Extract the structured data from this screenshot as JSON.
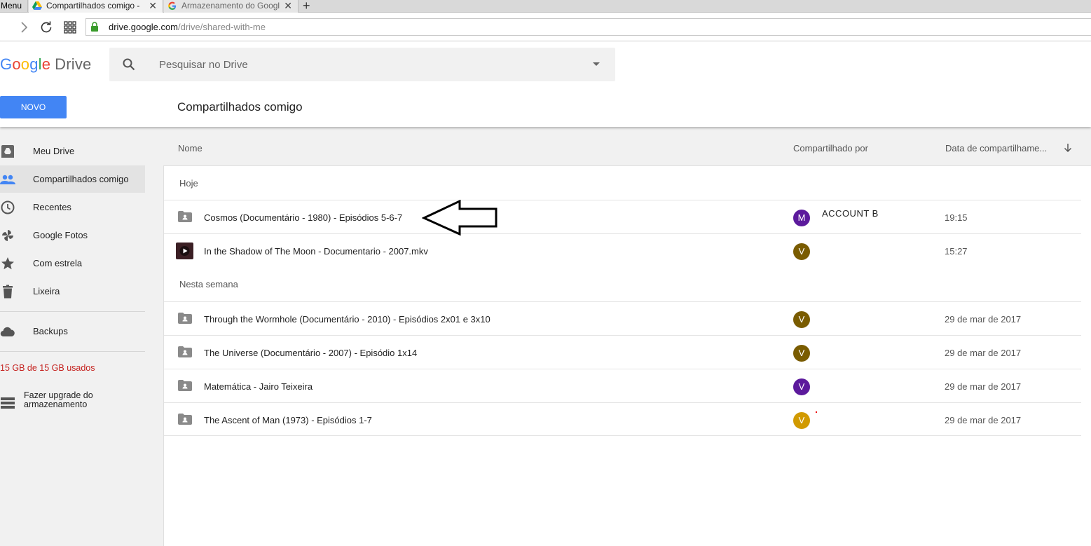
{
  "browser": {
    "menu_label": "Menu",
    "tabs": [
      {
        "title": "Compartilhados comigo -",
        "close": "✕"
      },
      {
        "title": "Armazenamento do Googl",
        "close": "✕"
      }
    ],
    "new_tab": "+",
    "url_domain": "drive.google.com",
    "url_path": "/drive/shared-with-me"
  },
  "header": {
    "logo_google": [
      "G",
      "o",
      "o",
      "g",
      "l",
      "e"
    ],
    "logo_drive": "Drive",
    "search_placeholder": "Pesquisar no Drive",
    "new_button": "NOVO",
    "page_title": "Compartilhados comigo"
  },
  "sidebar": {
    "items": [
      {
        "label": "Meu Drive",
        "icon": "drive-icon"
      },
      {
        "label": "Compartilhados comigo",
        "icon": "people-icon",
        "active": true
      },
      {
        "label": "Recentes",
        "icon": "clock-icon"
      },
      {
        "label": "Google Fotos",
        "icon": "pinwheel-icon"
      },
      {
        "label": "Com estrela",
        "icon": "star-icon"
      },
      {
        "label": "Lixeira",
        "icon": "trash-icon"
      }
    ],
    "backups": {
      "label": "Backups",
      "icon": "cloud-icon"
    },
    "storage": "15 GB de 15 GB usados",
    "upgrade_line1": "Fazer upgrade do",
    "upgrade_line2": "armazenamento"
  },
  "list": {
    "columns": {
      "name": "Nome",
      "shared_by": "Compartilhado por",
      "date": "Data de compartilhame..."
    },
    "groups": [
      {
        "label": "Hoje",
        "rows": [
          {
            "name": "Cosmos (Documentário - 1980) - Episódios 5-6-7",
            "type": "shared-folder",
            "avatar": "M",
            "avatar_color": "#5c1a9c",
            "sharer": "ACCOUNT B",
            "date": "19:15"
          },
          {
            "name": "In the Shadow of The Moon - Documentario - 2007.mkv",
            "type": "video",
            "avatar": "V",
            "avatar_color": "#7a5c00",
            "sharer": "",
            "date": "15:27"
          }
        ]
      },
      {
        "label": "Nesta semana",
        "rows": [
          {
            "name": "Through the Wormhole (Documentário - 2010) - Episódios 2x01 e 3x10",
            "type": "shared-folder",
            "avatar": "V",
            "avatar_color": "#7a5c00",
            "sharer": "",
            "date": "29 de mar de 2017"
          },
          {
            "name": "The Universe (Documentário - 2007) - Episódio 1x14",
            "type": "shared-folder",
            "avatar": "V",
            "avatar_color": "#7a5c00",
            "sharer": "",
            "date": "29 de mar de 2017"
          },
          {
            "name": "Matemática - Jairo Teixeira",
            "type": "shared-folder",
            "avatar": "V",
            "avatar_color": "#5c1a9c",
            "sharer": "",
            "date": "29 de mar de 2017"
          },
          {
            "name": "The Ascent of Man (1973) - Episódios 1-7",
            "type": "shared-folder",
            "avatar": "V",
            "avatar_color": "#d19a00",
            "sharer": "",
            "date": "29 de mar de 2017"
          }
        ]
      }
    ]
  }
}
